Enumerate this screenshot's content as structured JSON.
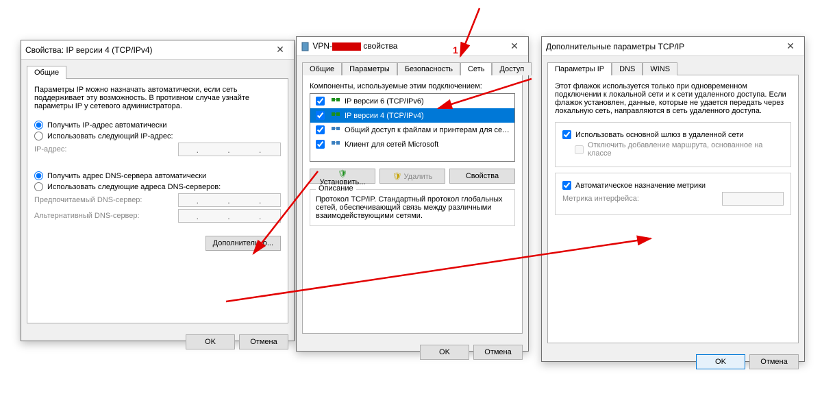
{
  "annotation": {
    "label_1": "1"
  },
  "dlg1": {
    "title": "Свойства: IP версии 4 (TCP/IPv4)",
    "tabs": {
      "general": "Общие"
    },
    "intro": "Параметры IP можно назначать автоматически, если сеть поддерживает эту возможность. В противном случае узнайте параметры IP у сетевого администратора.",
    "radio_auto_ip": "Получить IP-адрес автоматически",
    "radio_manual_ip": "Использовать следующий IP-адрес:",
    "label_ip": "IP-адрес:",
    "radio_auto_dns": "Получить адрес DNS-сервера автоматически",
    "radio_manual_dns": "Использовать следующие адреса DNS-серверов:",
    "label_dns1": "Предпочитаемый DNS-сервер:",
    "label_dns2": "Альтернативный DNS-сервер:",
    "ip_placeholder": ".       .       .",
    "btn_advanced": "Дополнительно...",
    "btn_ok": "OK",
    "btn_cancel": "Отмена"
  },
  "dlg2": {
    "title_prefix": "VPN-",
    "title_suffix": "свойства",
    "tabs": {
      "general": "Общие",
      "params": "Параметры",
      "security": "Безопасность",
      "net": "Сеть",
      "access": "Доступ"
    },
    "components_label": "Компоненты, используемые этим подключением:",
    "items": [
      {
        "label": "IP версии 6 (TCP/IPv6)",
        "selected": false
      },
      {
        "label": "IP версии 4 (TCP/IPv4)",
        "selected": true
      },
      {
        "label": "Общий доступ к файлам и принтерам для сетей Micr...",
        "selected": false
      },
      {
        "label": "Клиент для сетей Microsoft",
        "selected": false
      }
    ],
    "btn_install": "Установить...",
    "btn_remove": "Удалить",
    "btn_props": "Свойства",
    "desc_legend": "Описание",
    "desc_text": "Протокол TCP/IP. Стандартный протокол глобальных сетей, обеспечивающий связь между различными взаимодействующими сетями.",
    "btn_ok": "OK",
    "btn_cancel": "Отмена"
  },
  "dlg3": {
    "title": "Дополнительные параметры TCP/IP",
    "tabs": {
      "ip": "Параметры IP",
      "dns": "DNS",
      "wins": "WINS"
    },
    "intro": "Этот флажок используется только при одновременном подключении к локальной сети и к сети удаленного доступа. Если флажок установлен, данные, которые не удается передать через локальную сеть, направляются в сеть удаленного доступа.",
    "chk_default_gw": "Использовать основной шлюз в удаленной сети",
    "chk_class_route": "Отключить добавление маршрута, основанное на классе",
    "chk_auto_metric": "Автоматическое назначение метрики",
    "label_metric": "Метрика интерфейса:",
    "btn_ok": "OK",
    "btn_cancel": "Отмена"
  }
}
